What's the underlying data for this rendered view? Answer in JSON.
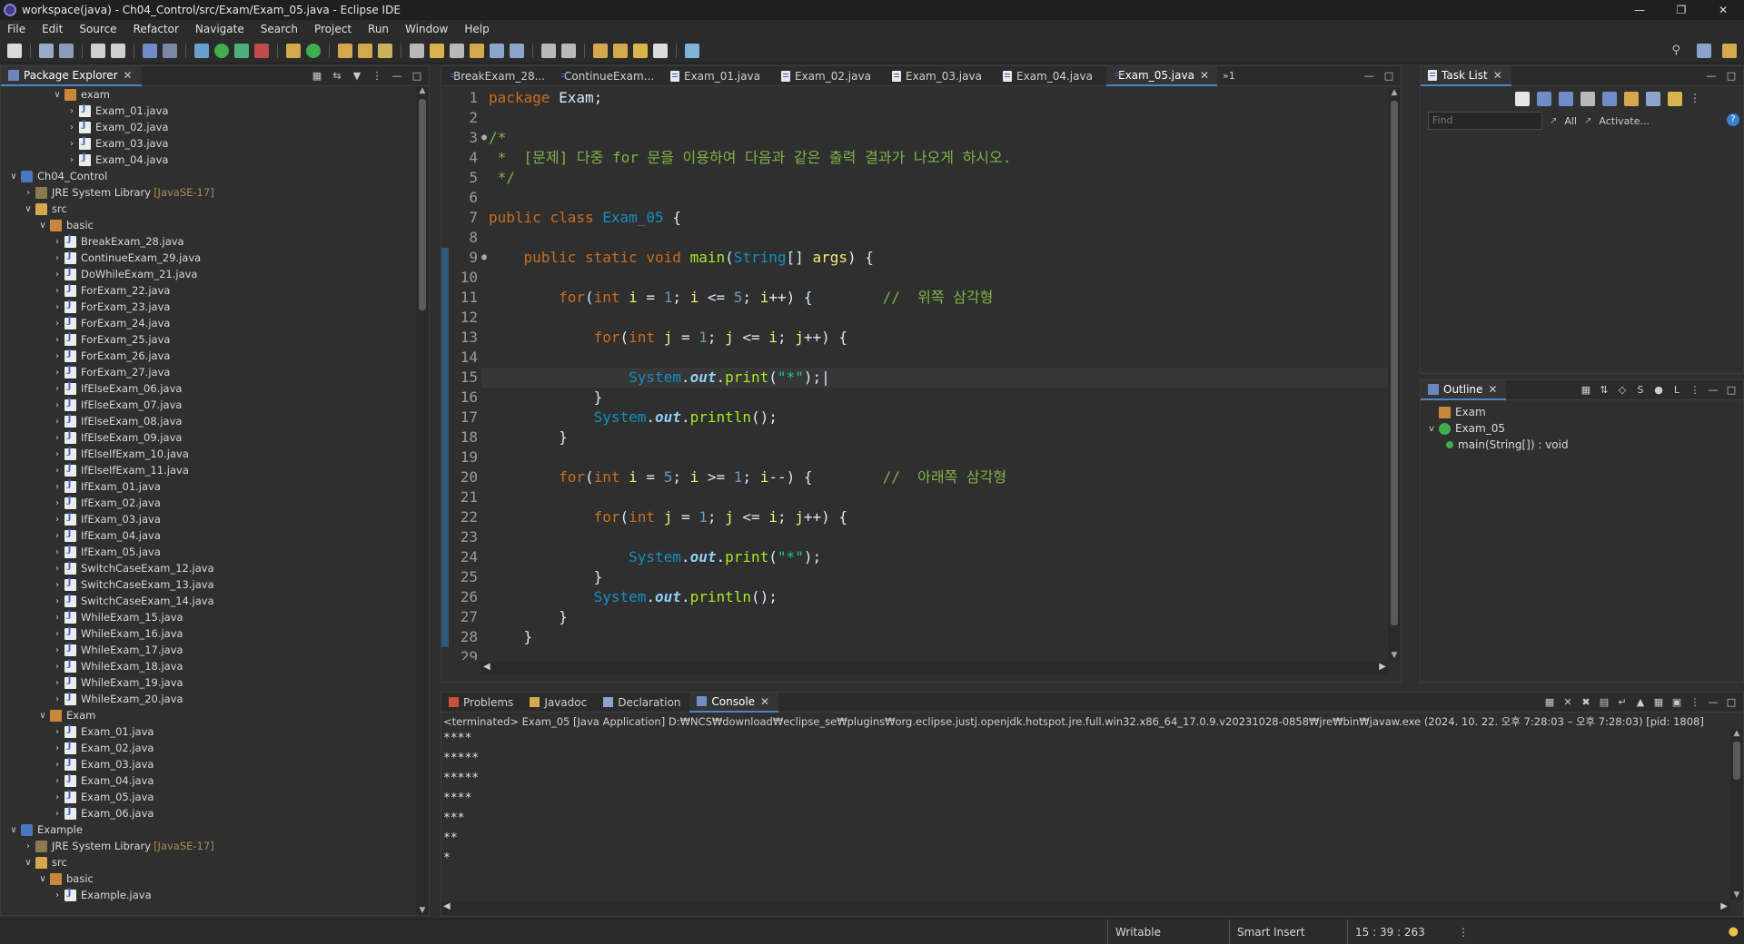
{
  "window": {
    "title": "workspace(java) - Ch04_Control/src/Exam/Exam_05.java - Eclipse IDE"
  },
  "menu": [
    "File",
    "Edit",
    "Source",
    "Refactor",
    "Navigate",
    "Search",
    "Project",
    "Run",
    "Window",
    "Help"
  ],
  "package_explorer": {
    "title": "Package Explorer",
    "rows": [
      {
        "indent": 3,
        "arrow": "v",
        "icon": "pkg",
        "label": "exam"
      },
      {
        "indent": 4,
        "arrow": ">",
        "icon": "java",
        "label": "Exam_01.java"
      },
      {
        "indent": 4,
        "arrow": ">",
        "icon": "java",
        "label": "Exam_02.java"
      },
      {
        "indent": 4,
        "arrow": ">",
        "icon": "java",
        "label": "Exam_03.java"
      },
      {
        "indent": 4,
        "arrow": ">",
        "icon": "java",
        "label": "Exam_04.java"
      },
      {
        "indent": 0,
        "arrow": "v",
        "icon": "proj",
        "label": "Ch04_Control"
      },
      {
        "indent": 1,
        "arrow": ">",
        "icon": "lib",
        "label": "JRE System Library",
        "extra": "[JavaSE-17]"
      },
      {
        "indent": 1,
        "arrow": "v",
        "icon": "src",
        "label": "src"
      },
      {
        "indent": 2,
        "arrow": "v",
        "icon": "pkg",
        "label": "basic"
      },
      {
        "indent": 3,
        "arrow": ">",
        "icon": "java",
        "label": "BreakExam_28.java"
      },
      {
        "indent": 3,
        "arrow": ">",
        "icon": "java",
        "label": "ContinueExam_29.java"
      },
      {
        "indent": 3,
        "arrow": ">",
        "icon": "java",
        "label": "DoWhileExam_21.java"
      },
      {
        "indent": 3,
        "arrow": ">",
        "icon": "java",
        "label": "ForExam_22.java"
      },
      {
        "indent": 3,
        "arrow": ">",
        "icon": "java",
        "label": "ForExam_23.java"
      },
      {
        "indent": 3,
        "arrow": ">",
        "icon": "java",
        "label": "ForExam_24.java"
      },
      {
        "indent": 3,
        "arrow": ">",
        "icon": "java",
        "label": "ForExam_25.java"
      },
      {
        "indent": 3,
        "arrow": ">",
        "icon": "java",
        "label": "ForExam_26.java"
      },
      {
        "indent": 3,
        "arrow": ">",
        "icon": "java",
        "label": "ForExam_27.java"
      },
      {
        "indent": 3,
        "arrow": ">",
        "icon": "java",
        "label": "IfElseExam_06.java"
      },
      {
        "indent": 3,
        "arrow": ">",
        "icon": "java",
        "label": "IfElseExam_07.java"
      },
      {
        "indent": 3,
        "arrow": ">",
        "icon": "java",
        "label": "IfElseExam_08.java"
      },
      {
        "indent": 3,
        "arrow": ">",
        "icon": "java",
        "label": "IfElseExam_09.java"
      },
      {
        "indent": 3,
        "arrow": ">",
        "icon": "java",
        "label": "IfElseIfExam_10.java"
      },
      {
        "indent": 3,
        "arrow": ">",
        "icon": "java",
        "label": "IfElseIfExam_11.java"
      },
      {
        "indent": 3,
        "arrow": ">",
        "icon": "java",
        "label": "IfExam_01.java"
      },
      {
        "indent": 3,
        "arrow": ">",
        "icon": "java",
        "label": "IfExam_02.java"
      },
      {
        "indent": 3,
        "arrow": ">",
        "icon": "java",
        "label": "IfExam_03.java"
      },
      {
        "indent": 3,
        "arrow": ">",
        "icon": "java",
        "label": "IfExam_04.java"
      },
      {
        "indent": 3,
        "arrow": ">",
        "icon": "java",
        "label": "IfExam_05.java"
      },
      {
        "indent": 3,
        "arrow": ">",
        "icon": "java",
        "label": "SwitchCaseExam_12.java"
      },
      {
        "indent": 3,
        "arrow": ">",
        "icon": "java",
        "label": "SwitchCaseExam_13.java"
      },
      {
        "indent": 3,
        "arrow": ">",
        "icon": "java",
        "label": "SwitchCaseExam_14.java"
      },
      {
        "indent": 3,
        "arrow": ">",
        "icon": "java",
        "label": "WhileExam_15.java"
      },
      {
        "indent": 3,
        "arrow": ">",
        "icon": "java",
        "label": "WhileExam_16.java"
      },
      {
        "indent": 3,
        "arrow": ">",
        "icon": "java",
        "label": "WhileExam_17.java"
      },
      {
        "indent": 3,
        "arrow": ">",
        "icon": "java",
        "label": "WhileExam_18.java"
      },
      {
        "indent": 3,
        "arrow": ">",
        "icon": "java",
        "label": "WhileExam_19.java"
      },
      {
        "indent": 3,
        "arrow": ">",
        "icon": "java",
        "label": "WhileExam_20.java"
      },
      {
        "indent": 2,
        "arrow": "v",
        "icon": "pkg",
        "label": "Exam"
      },
      {
        "indent": 3,
        "arrow": ">",
        "icon": "java",
        "label": "Exam_01.java"
      },
      {
        "indent": 3,
        "arrow": ">",
        "icon": "java",
        "label": "Exam_02.java"
      },
      {
        "indent": 3,
        "arrow": ">",
        "icon": "java",
        "label": "Exam_03.java"
      },
      {
        "indent": 3,
        "arrow": ">",
        "icon": "java",
        "label": "Exam_04.java"
      },
      {
        "indent": 3,
        "arrow": ">",
        "icon": "java",
        "label": "Exam_05.java"
      },
      {
        "indent": 3,
        "arrow": ">",
        "icon": "java",
        "label": "Exam_06.java"
      },
      {
        "indent": 0,
        "arrow": "v",
        "icon": "proj",
        "label": "Example"
      },
      {
        "indent": 1,
        "arrow": ">",
        "icon": "lib",
        "label": "JRE System Library",
        "extra": "[JavaSE-17]"
      },
      {
        "indent": 1,
        "arrow": "v",
        "icon": "src",
        "label": "src"
      },
      {
        "indent": 2,
        "arrow": "v",
        "icon": "pkg",
        "label": "basic"
      },
      {
        "indent": 3,
        "arrow": ">",
        "icon": "java",
        "label": "Example.java"
      }
    ]
  },
  "editor": {
    "tabs": [
      {
        "label": "BreakExam_28...",
        "active": false
      },
      {
        "label": "ContinueExam...",
        "active": false
      },
      {
        "label": "Exam_01.java",
        "active": false
      },
      {
        "label": "Exam_02.java",
        "active": false
      },
      {
        "label": "Exam_03.java",
        "active": false
      },
      {
        "label": "Exam_04.java",
        "active": false
      },
      {
        "label": "Exam_05.java",
        "active": true
      }
    ],
    "overflow_label": "»1",
    "lines": [
      [
        [
          "kw",
          "package"
        ],
        [
          "t",
          " Exam;"
        ]
      ],
      [],
      [
        [
          "cm",
          "/*"
        ]
      ],
      [
        [
          "cm",
          " *  [문제] 다중 for 문을 이용하여 다음과 같은 출력 결과가 나오게 하시오."
        ]
      ],
      [
        [
          "cm",
          " */"
        ]
      ],
      [],
      [
        [
          "kw",
          "public"
        ],
        [
          "t",
          " "
        ],
        [
          "kw",
          "class"
        ],
        [
          "t",
          " "
        ],
        [
          "cls",
          "Exam_05"
        ],
        [
          "t",
          " {"
        ]
      ],
      [],
      [
        [
          "t",
          "    "
        ],
        [
          "kw",
          "public"
        ],
        [
          "t",
          " "
        ],
        [
          "kw",
          "static"
        ],
        [
          "t",
          " "
        ],
        [
          "kw",
          "void"
        ],
        [
          "t",
          " "
        ],
        [
          "meth",
          "main"
        ],
        [
          "t",
          "("
        ],
        [
          "ty",
          "String"
        ],
        [
          "t",
          "[] "
        ],
        [
          "var",
          "args"
        ],
        [
          "t",
          ") {"
        ]
      ],
      [],
      [
        [
          "t",
          "        "
        ],
        [
          "kw",
          "for"
        ],
        [
          "t",
          "("
        ],
        [
          "kw",
          "int"
        ],
        [
          "t",
          " "
        ],
        [
          "var",
          "i"
        ],
        [
          "t",
          " = "
        ],
        [
          "num",
          "1"
        ],
        [
          "t",
          "; "
        ],
        [
          "var",
          "i"
        ],
        [
          "t",
          " <= "
        ],
        [
          "num",
          "5"
        ],
        [
          "t",
          "; "
        ],
        [
          "var",
          "i"
        ],
        [
          "t",
          "++) {        "
        ],
        [
          "cm",
          "//  위쪽 삼각형"
        ]
      ],
      [],
      [
        [
          "t",
          "            "
        ],
        [
          "kw",
          "for"
        ],
        [
          "t",
          "("
        ],
        [
          "kw",
          "int"
        ],
        [
          "t",
          " "
        ],
        [
          "var",
          "j"
        ],
        [
          "t",
          " = "
        ],
        [
          "num",
          "1"
        ],
        [
          "t",
          "; "
        ],
        [
          "var",
          "j"
        ],
        [
          "t",
          " <= "
        ],
        [
          "var",
          "i"
        ],
        [
          "t",
          "; "
        ],
        [
          "var",
          "j"
        ],
        [
          "t",
          "++) {"
        ]
      ],
      [],
      [
        [
          "t",
          "                "
        ],
        [
          "cls",
          "System"
        ],
        [
          "t",
          "."
        ],
        [
          "fld",
          "out"
        ],
        [
          "t",
          "."
        ],
        [
          "meth",
          "print"
        ],
        [
          "t",
          "("
        ],
        [
          "str",
          "\"*\""
        ],
        [
          "t",
          ");|"
        ]
      ],
      [
        [
          "t",
          "            }"
        ]
      ],
      [
        [
          "t",
          "            "
        ],
        [
          "cls",
          "System"
        ],
        [
          "t",
          "."
        ],
        [
          "fld",
          "out"
        ],
        [
          "t",
          "."
        ],
        [
          "meth",
          "println"
        ],
        [
          "t",
          "();"
        ]
      ],
      [
        [
          "t",
          "        }"
        ]
      ],
      [],
      [
        [
          "t",
          "        "
        ],
        [
          "kw",
          "for"
        ],
        [
          "t",
          "("
        ],
        [
          "kw",
          "int"
        ],
        [
          "t",
          " "
        ],
        [
          "var",
          "i"
        ],
        [
          "t",
          " = "
        ],
        [
          "num",
          "5"
        ],
        [
          "t",
          "; "
        ],
        [
          "var",
          "i"
        ],
        [
          "t",
          " >= "
        ],
        [
          "num",
          "1"
        ],
        [
          "t",
          "; "
        ],
        [
          "var",
          "i"
        ],
        [
          "t",
          "--) {        "
        ],
        [
          "cm",
          "//  아래쪽 삼각형"
        ]
      ],
      [],
      [
        [
          "t",
          "            "
        ],
        [
          "kw",
          "for"
        ],
        [
          "t",
          "("
        ],
        [
          "kw",
          "int"
        ],
        [
          "t",
          " "
        ],
        [
          "var",
          "j"
        ],
        [
          "t",
          " = "
        ],
        [
          "num",
          "1"
        ],
        [
          "t",
          "; "
        ],
        [
          "var",
          "j"
        ],
        [
          "t",
          " <= "
        ],
        [
          "var",
          "i"
        ],
        [
          "t",
          "; "
        ],
        [
          "var",
          "j"
        ],
        [
          "t",
          "++) {"
        ]
      ],
      [],
      [
        [
          "t",
          "                "
        ],
        [
          "cls",
          "System"
        ],
        [
          "t",
          "."
        ],
        [
          "fld",
          "out"
        ],
        [
          "t",
          "."
        ],
        [
          "meth",
          "print"
        ],
        [
          "t",
          "("
        ],
        [
          "str",
          "\"*\""
        ],
        [
          "t",
          ");"
        ]
      ],
      [
        [
          "t",
          "            }"
        ]
      ],
      [
        [
          "t",
          "            "
        ],
        [
          "cls",
          "System"
        ],
        [
          "t",
          "."
        ],
        [
          "fld",
          "out"
        ],
        [
          "t",
          "."
        ],
        [
          "meth",
          "println"
        ],
        [
          "t",
          "();"
        ]
      ],
      [
        [
          "t",
          "        }"
        ]
      ],
      [
        [
          "t",
          "    }"
        ]
      ],
      []
    ]
  },
  "task_list": {
    "title": "Task List",
    "find_placeholder": "Find",
    "all_label": "All",
    "activate_label": "Activate..."
  },
  "outline": {
    "title": "Outline",
    "items": [
      {
        "label": "Exam",
        "icon": "pkg",
        "indent": 0
      },
      {
        "label": "Exam_05",
        "icon": "class",
        "indent": 0
      },
      {
        "label": "main(String[]) : void",
        "icon": "method",
        "indent": 1
      }
    ]
  },
  "console": {
    "tabs": [
      {
        "label": "Problems",
        "active": false
      },
      {
        "label": "Javadoc",
        "active": false
      },
      {
        "label": "Declaration",
        "active": false
      },
      {
        "label": "Console",
        "active": true
      }
    ],
    "process": "<terminated> Exam_05 [Java Application] D:₩NCS₩download₩eclipse_se₩plugins₩org.eclipse.justj.openjdk.hotspot.jre.full.win32.x86_64_17.0.9.v20231028-0858₩jre₩bin₩javaw.exe  (2024. 10. 22. 오후 7:28:03 – 오후 7:28:03) [pid: 1808]",
    "output": [
      "****",
      "*****",
      "*****",
      "****",
      "***",
      "**",
      "*"
    ]
  },
  "status": {
    "writable": "Writable",
    "insert_mode": "Smart Insert",
    "position": "15 : 39 : 263"
  },
  "colors": {
    "accent": "#4d84c8",
    "keyword": "#cc6c1d",
    "comment": "#7fb347",
    "string": "#17c6a3"
  }
}
